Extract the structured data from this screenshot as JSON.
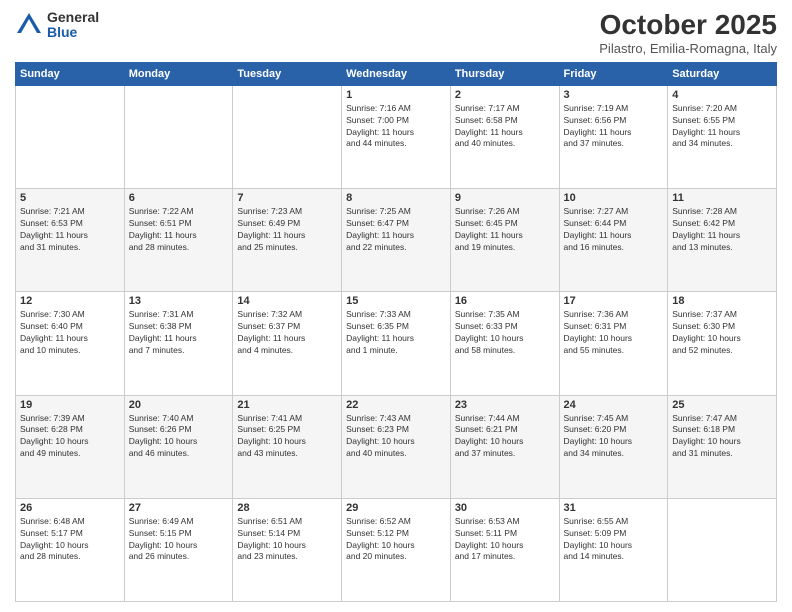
{
  "logo": {
    "general": "General",
    "blue": "Blue"
  },
  "header": {
    "month": "October 2025",
    "location": "Pilastro, Emilia-Romagna, Italy"
  },
  "weekdays": [
    "Sunday",
    "Monday",
    "Tuesday",
    "Wednesday",
    "Thursday",
    "Friday",
    "Saturday"
  ],
  "weeks": [
    [
      {
        "day": "",
        "info": ""
      },
      {
        "day": "",
        "info": ""
      },
      {
        "day": "",
        "info": ""
      },
      {
        "day": "1",
        "info": "Sunrise: 7:16 AM\nSunset: 7:00 PM\nDaylight: 11 hours\nand 44 minutes."
      },
      {
        "day": "2",
        "info": "Sunrise: 7:17 AM\nSunset: 6:58 PM\nDaylight: 11 hours\nand 40 minutes."
      },
      {
        "day": "3",
        "info": "Sunrise: 7:19 AM\nSunset: 6:56 PM\nDaylight: 11 hours\nand 37 minutes."
      },
      {
        "day": "4",
        "info": "Sunrise: 7:20 AM\nSunset: 6:55 PM\nDaylight: 11 hours\nand 34 minutes."
      }
    ],
    [
      {
        "day": "5",
        "info": "Sunrise: 7:21 AM\nSunset: 6:53 PM\nDaylight: 11 hours\nand 31 minutes."
      },
      {
        "day": "6",
        "info": "Sunrise: 7:22 AM\nSunset: 6:51 PM\nDaylight: 11 hours\nand 28 minutes."
      },
      {
        "day": "7",
        "info": "Sunrise: 7:23 AM\nSunset: 6:49 PM\nDaylight: 11 hours\nand 25 minutes."
      },
      {
        "day": "8",
        "info": "Sunrise: 7:25 AM\nSunset: 6:47 PM\nDaylight: 11 hours\nand 22 minutes."
      },
      {
        "day": "9",
        "info": "Sunrise: 7:26 AM\nSunset: 6:45 PM\nDaylight: 11 hours\nand 19 minutes."
      },
      {
        "day": "10",
        "info": "Sunrise: 7:27 AM\nSunset: 6:44 PM\nDaylight: 11 hours\nand 16 minutes."
      },
      {
        "day": "11",
        "info": "Sunrise: 7:28 AM\nSunset: 6:42 PM\nDaylight: 11 hours\nand 13 minutes."
      }
    ],
    [
      {
        "day": "12",
        "info": "Sunrise: 7:30 AM\nSunset: 6:40 PM\nDaylight: 11 hours\nand 10 minutes."
      },
      {
        "day": "13",
        "info": "Sunrise: 7:31 AM\nSunset: 6:38 PM\nDaylight: 11 hours\nand 7 minutes."
      },
      {
        "day": "14",
        "info": "Sunrise: 7:32 AM\nSunset: 6:37 PM\nDaylight: 11 hours\nand 4 minutes."
      },
      {
        "day": "15",
        "info": "Sunrise: 7:33 AM\nSunset: 6:35 PM\nDaylight: 11 hours\nand 1 minute."
      },
      {
        "day": "16",
        "info": "Sunrise: 7:35 AM\nSunset: 6:33 PM\nDaylight: 10 hours\nand 58 minutes."
      },
      {
        "day": "17",
        "info": "Sunrise: 7:36 AM\nSunset: 6:31 PM\nDaylight: 10 hours\nand 55 minutes."
      },
      {
        "day": "18",
        "info": "Sunrise: 7:37 AM\nSunset: 6:30 PM\nDaylight: 10 hours\nand 52 minutes."
      }
    ],
    [
      {
        "day": "19",
        "info": "Sunrise: 7:39 AM\nSunset: 6:28 PM\nDaylight: 10 hours\nand 49 minutes."
      },
      {
        "day": "20",
        "info": "Sunrise: 7:40 AM\nSunset: 6:26 PM\nDaylight: 10 hours\nand 46 minutes."
      },
      {
        "day": "21",
        "info": "Sunrise: 7:41 AM\nSunset: 6:25 PM\nDaylight: 10 hours\nand 43 minutes."
      },
      {
        "day": "22",
        "info": "Sunrise: 7:43 AM\nSunset: 6:23 PM\nDaylight: 10 hours\nand 40 minutes."
      },
      {
        "day": "23",
        "info": "Sunrise: 7:44 AM\nSunset: 6:21 PM\nDaylight: 10 hours\nand 37 minutes."
      },
      {
        "day": "24",
        "info": "Sunrise: 7:45 AM\nSunset: 6:20 PM\nDaylight: 10 hours\nand 34 minutes."
      },
      {
        "day": "25",
        "info": "Sunrise: 7:47 AM\nSunset: 6:18 PM\nDaylight: 10 hours\nand 31 minutes."
      }
    ],
    [
      {
        "day": "26",
        "info": "Sunrise: 6:48 AM\nSunset: 5:17 PM\nDaylight: 10 hours\nand 28 minutes."
      },
      {
        "day": "27",
        "info": "Sunrise: 6:49 AM\nSunset: 5:15 PM\nDaylight: 10 hours\nand 26 minutes."
      },
      {
        "day": "28",
        "info": "Sunrise: 6:51 AM\nSunset: 5:14 PM\nDaylight: 10 hours\nand 23 minutes."
      },
      {
        "day": "29",
        "info": "Sunrise: 6:52 AM\nSunset: 5:12 PM\nDaylight: 10 hours\nand 20 minutes."
      },
      {
        "day": "30",
        "info": "Sunrise: 6:53 AM\nSunset: 5:11 PM\nDaylight: 10 hours\nand 17 minutes."
      },
      {
        "day": "31",
        "info": "Sunrise: 6:55 AM\nSunset: 5:09 PM\nDaylight: 10 hours\nand 14 minutes."
      },
      {
        "day": "",
        "info": ""
      }
    ]
  ]
}
